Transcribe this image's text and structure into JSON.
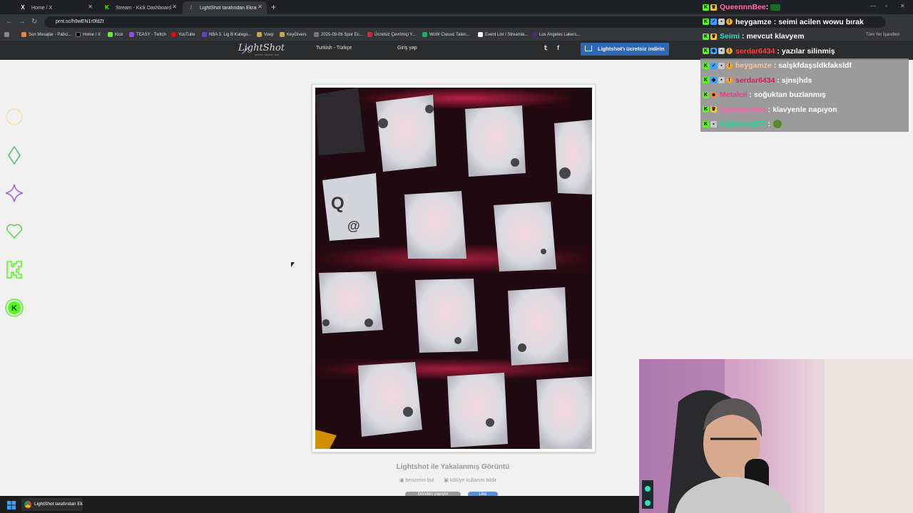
{
  "browser": {
    "tabs": [
      {
        "title": "Home / X",
        "icon": "x-logo-icon"
      },
      {
        "title": "Stream - Kick Dashboard",
        "icon": "kick-logo-icon"
      },
      {
        "title": "LightShot tarafından Ekran Görü",
        "icon": "lightshot-feather-icon"
      }
    ],
    "url": "prnt.sc/h9wEN1r0fdZt",
    "bookmarks": [
      "Son Mesajlar - Pabci...",
      "Home / X",
      "Kick",
      "TEASY - Twitch",
      "YouTube",
      "NBA 3. Lig B Katego...",
      "Voep",
      "KeyGivers",
      "2025-09-06 Spor Ec...",
      "Ücretsiz Çevrimiçi Y...",
      "WoW Classic Talen...",
      "Event List / Streamla...",
      "Los Angeles Lakers..."
    ],
    "all_bookmarks": "Tüm Yer İşaretleri"
  },
  "lightshot": {
    "logo": "LightShot",
    "logo_sub": "screen capture tool",
    "language": "Turkish - Türkçe",
    "login": "Giriş yap",
    "download": "Lightshot'ı ücretsiz indirin",
    "caption": "Lightshot ile Yakalanmış Görüntü",
    "find_similar": "benzerini bul",
    "report": "kötüye kullanım bildir",
    "pill1": "Gönderi yapıştır",
    "pill2": "Like"
  },
  "sidebar_icons": [
    "circle-outline-icon",
    "diamond-icon",
    "sparkle-icon",
    "heart-icon",
    "kick-outline-icon",
    "kick-circle-icon"
  ],
  "chat": [
    {
      "user": "QueennnBee",
      "msg": "",
      "user_color": "#ff6fb0",
      "highlight": false,
      "emote": "frog-emote"
    },
    {
      "user": "heygamze",
      "msg": "seimi acilen wowu bırak",
      "user_color": "#ffffff",
      "highlight": false
    },
    {
      "user": "Seimi",
      "msg": "mevcut klavyem",
      "user_color": "#29e0c5",
      "highlight": false
    },
    {
      "user": "serdar6434",
      "msg": "yazılar silinmiş",
      "user_color": "#ff3d3d",
      "highlight": false
    },
    {
      "user": "heygamze",
      "msg": "salşkfdaşsldkfaksldf",
      "user_color": "#f2c3a0",
      "highlight": true
    },
    {
      "user": "serdar6434",
      "msg": "sjnsjhds",
      "user_color": "#e4165f",
      "highlight": true
    },
    {
      "user": "Metalcii",
      "msg": "soğuktan buzlanmış",
      "user_color": "#e03c8a",
      "highlight": true
    },
    {
      "user": "QueennnBee",
      "msg": "klavyenle napıyon",
      "user_color": "#ff5fa8",
      "highlight": true
    },
    {
      "user": "NightwingTR",
      "msg": "",
      "user_color": "#1fd690",
      "highlight": true,
      "emote": "peepo-emote"
    }
  ],
  "taskbar": {
    "item": "LightShot tarafından Ek"
  },
  "colors": {
    "accent_blue": "#2f67b3",
    "kick_green": "#53fc18",
    "page_bg": "#f1f1f1"
  }
}
